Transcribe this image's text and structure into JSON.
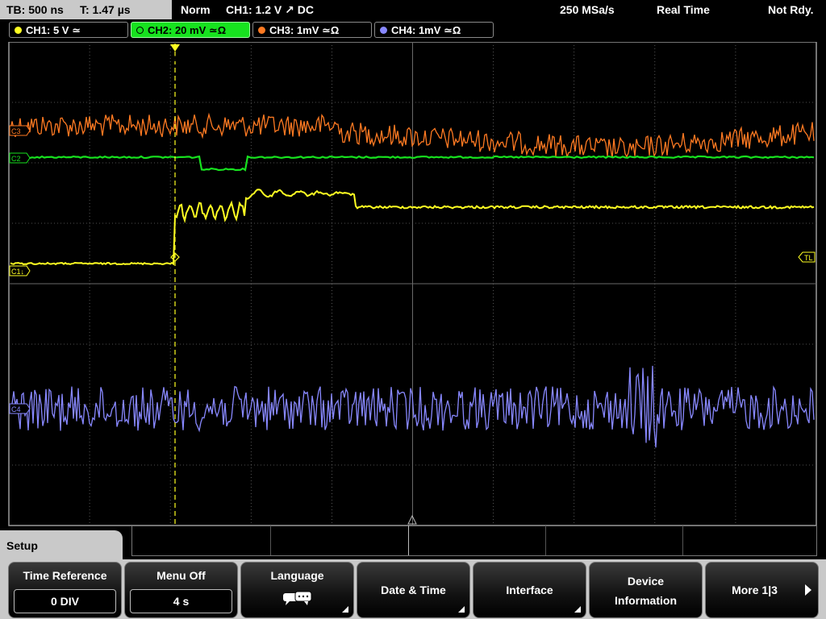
{
  "status": {
    "timebase": "TB: 500 ns",
    "trigger_time": "T: 1.47 µs",
    "trigger_mode": "Norm",
    "trigger_info": "CH1: 1.2 V ↗ DC",
    "sample_rate": "250 MSa/s",
    "acq_mode": "Real Time",
    "state": "Not Rdy."
  },
  "channels": [
    {
      "id": "ch1",
      "label": "CH1: 5 V ≃",
      "color": "#ffff22",
      "active": false
    },
    {
      "id": "ch2",
      "label": "CH2: 20 mV ≃Ω",
      "color": "#17e21f",
      "active": true
    },
    {
      "id": "ch3",
      "label": "CH3: 1mV ≃Ω",
      "color": "#ff7a22",
      "active": false
    },
    {
      "id": "ch4",
      "label": "CH4: 1mV ≃Ω",
      "color": "#8888ff",
      "active": false
    }
  ],
  "markers": {
    "ch1": "C1↓",
    "ch2": "C2",
    "ch3": "C3",
    "ch4": "C4",
    "trigger_level": "TL",
    "trigger_pos": "T"
  },
  "menu": {
    "title": "Setup",
    "softkeys": [
      {
        "label": "Time Reference",
        "value": "0 DIV"
      },
      {
        "label": "Menu Off",
        "value": "4 s"
      },
      {
        "label": "Language",
        "icon": "speech-bubbles-icon"
      },
      {
        "label": "Date & Time"
      },
      {
        "label": "Interface"
      },
      {
        "label": "Device",
        "label2": "Information"
      },
      {
        "label": "More 1|3",
        "icon": "arrow-right-icon"
      }
    ]
  }
}
